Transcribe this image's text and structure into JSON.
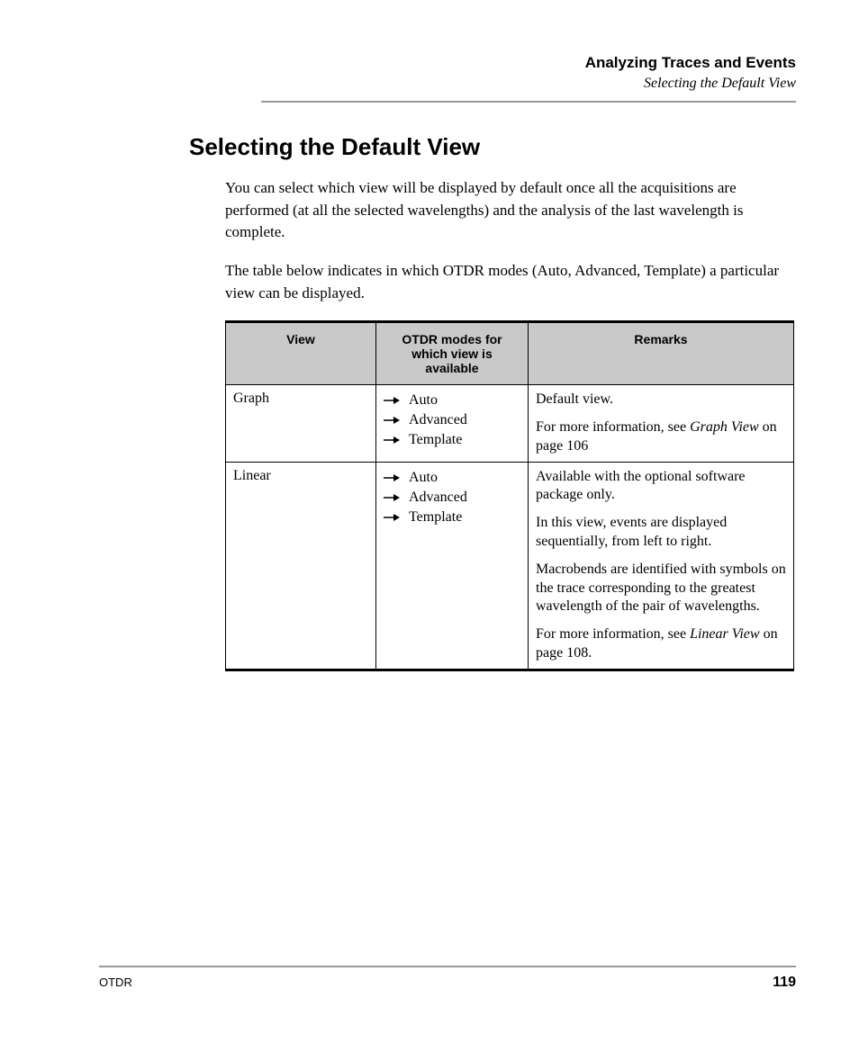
{
  "running_head": {
    "chapter": "Analyzing Traces and Events",
    "section": "Selecting the Default View"
  },
  "heading": "Selecting the Default View",
  "paragraphs": [
    "You can select which view will be displayed by default once all the acquisitions are performed (at all the selected wavelengths) and the analysis of the last wavelength is complete.",
    "The table below indicates in which OTDR modes (Auto, Advanced, Template) a particular view can be displayed."
  ],
  "table": {
    "headers": {
      "view": "View",
      "modes": "OTDR modes for which view is available",
      "remarks": "Remarks"
    },
    "rows": [
      {
        "view": "Graph",
        "modes": [
          "Auto",
          "Advanced",
          "Template"
        ],
        "remarks": [
          {
            "pre": "Default view."
          },
          {
            "pre": "For more information, see ",
            "link_italic": "Graph View",
            "post": " on page 106"
          }
        ]
      },
      {
        "view": "Linear",
        "modes": [
          "Auto",
          "Advanced",
          "Template"
        ],
        "remarks": [
          {
            "pre": "Available with the optional software package only."
          },
          {
            "pre": "In this view, events are displayed sequentially, from left to right."
          },
          {
            "pre": "Macrobends are identified with symbols on the trace corresponding to the greatest wavelength of the pair of wavelengths."
          },
          {
            "pre": "For more information, see ",
            "link_italic": "Linear View",
            "post": " on page 108."
          }
        ]
      }
    ]
  },
  "footer": {
    "product": "OTDR",
    "page": "119"
  }
}
